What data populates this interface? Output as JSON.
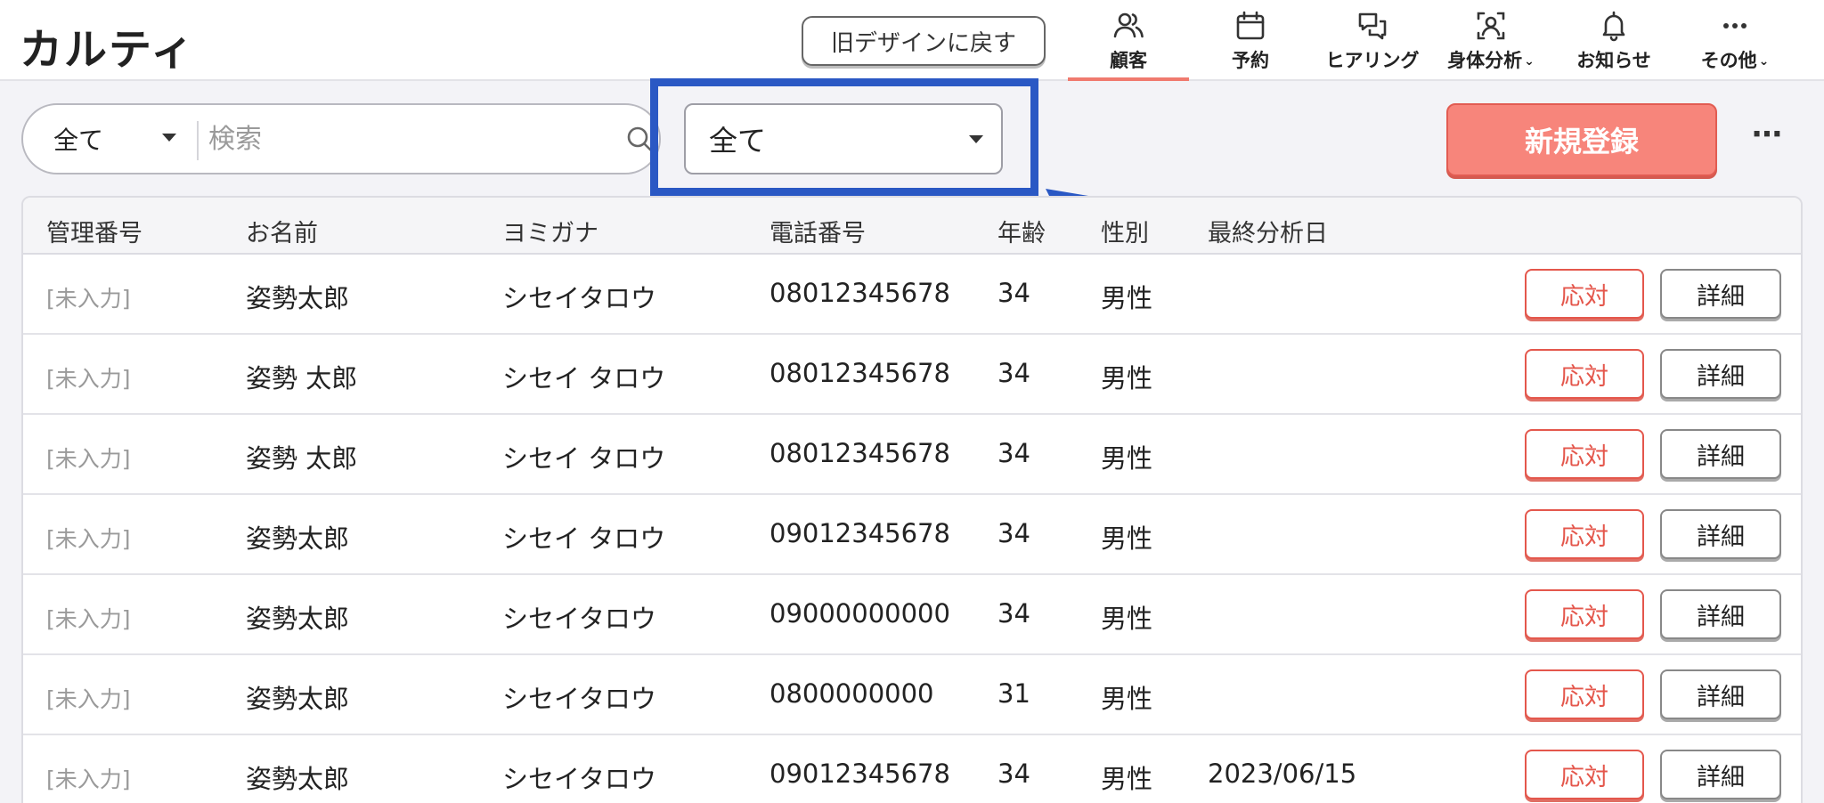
{
  "app": {
    "logo": "カルティ"
  },
  "header": {
    "old_design_label": "旧デザインに戻す",
    "nav": [
      {
        "label": "顧客",
        "icon": "users-icon",
        "active": true
      },
      {
        "label": "予約",
        "icon": "calendar-icon",
        "active": false
      },
      {
        "label": "ヒアリング",
        "icon": "chat-icon",
        "active": false
      },
      {
        "label": "身体分析",
        "icon": "body-scan-icon",
        "active": false,
        "dropdown": true
      },
      {
        "label": "お知らせ",
        "icon": "bell-icon",
        "active": false
      },
      {
        "label": "その他",
        "icon": "more-horizontal-icon",
        "active": false,
        "dropdown": true
      }
    ]
  },
  "toolbar": {
    "search_scope": "全て",
    "search_placeholder": "検索",
    "filter_value": "全て",
    "new_button": "新規登録",
    "more_button": "⋯"
  },
  "colors": {
    "accent": "#f7857b",
    "highlight": "#2a58c4",
    "respond": "#e4574c"
  },
  "table": {
    "columns": [
      "管理番号",
      "お名前",
      "ヨミガナ",
      "電話番号",
      "年齢",
      "性別",
      "最終分析日"
    ],
    "rows": [
      {
        "id": "[未入力]",
        "name": "姿勢太郎",
        "kana": "シセイタロウ",
        "phone": "08012345678",
        "age": "34",
        "gender": "男性",
        "last": ""
      },
      {
        "id": "[未入力]",
        "name": "姿勢 太郎",
        "kana": "シセイ タロウ",
        "phone": "08012345678",
        "age": "34",
        "gender": "男性",
        "last": ""
      },
      {
        "id": "[未入力]",
        "name": "姿勢 太郎",
        "kana": "シセイ タロウ",
        "phone": "08012345678",
        "age": "34",
        "gender": "男性",
        "last": ""
      },
      {
        "id": "[未入力]",
        "name": "姿勢太郎",
        "kana": "シセイ タロウ",
        "phone": "09012345678",
        "age": "34",
        "gender": "男性",
        "last": ""
      },
      {
        "id": "[未入力]",
        "name": "姿勢太郎",
        "kana": "シセイタロウ",
        "phone": "09000000000",
        "age": "34",
        "gender": "男性",
        "last": ""
      },
      {
        "id": "[未入力]",
        "name": "姿勢太郎",
        "kana": "シセイタロウ",
        "phone": "0800000000",
        "age": "31",
        "gender": "男性",
        "last": ""
      },
      {
        "id": "[未入力]",
        "name": "姿勢太郎",
        "kana": "シセイタロウ",
        "phone": "09012345678",
        "age": "34",
        "gender": "男性",
        "last": "2023/06/15"
      }
    ],
    "respond_label": "応対",
    "detail_label": "詳細"
  }
}
